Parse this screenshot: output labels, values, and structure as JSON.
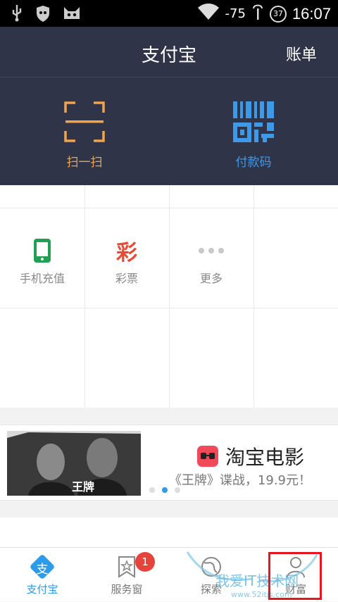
{
  "status_bar": {
    "signal": "-75",
    "badge": "37",
    "time": "16:07"
  },
  "header": {
    "title": "支付宝",
    "bill": "账单"
  },
  "hero": {
    "scan_label": "扫一扫",
    "pay_label": "付款码",
    "scan_color": "#f0a54a",
    "pay_color": "#3d9ae8"
  },
  "grid": {
    "items": [
      {
        "label": "手机充值",
        "icon": "phone-icon"
      },
      {
        "label": "彩票",
        "icon": "lottery-icon",
        "glyph": "彩"
      },
      {
        "label": "更多",
        "icon": "more-icon"
      }
    ]
  },
  "banner": {
    "poster_title": "王牌",
    "brand_title": "淘宝电影",
    "promo": "《王牌》谍战，19.9元！",
    "active_dot": 1
  },
  "tabbar": {
    "items": [
      {
        "label": "支付宝",
        "icon": "alipay-icon"
      },
      {
        "label": "服务窗",
        "icon": "star-bookmark-icon"
      },
      {
        "label": "探索",
        "icon": "globe-icon"
      },
      {
        "label": "财富",
        "icon": "wealth-icon"
      }
    ],
    "badge_count": "1",
    "alipay_glyph": "支",
    "active_color": "#2c9bea"
  },
  "watermark": {
    "text": "我爱IT技术网",
    "url": "www.52itjs.com"
  }
}
